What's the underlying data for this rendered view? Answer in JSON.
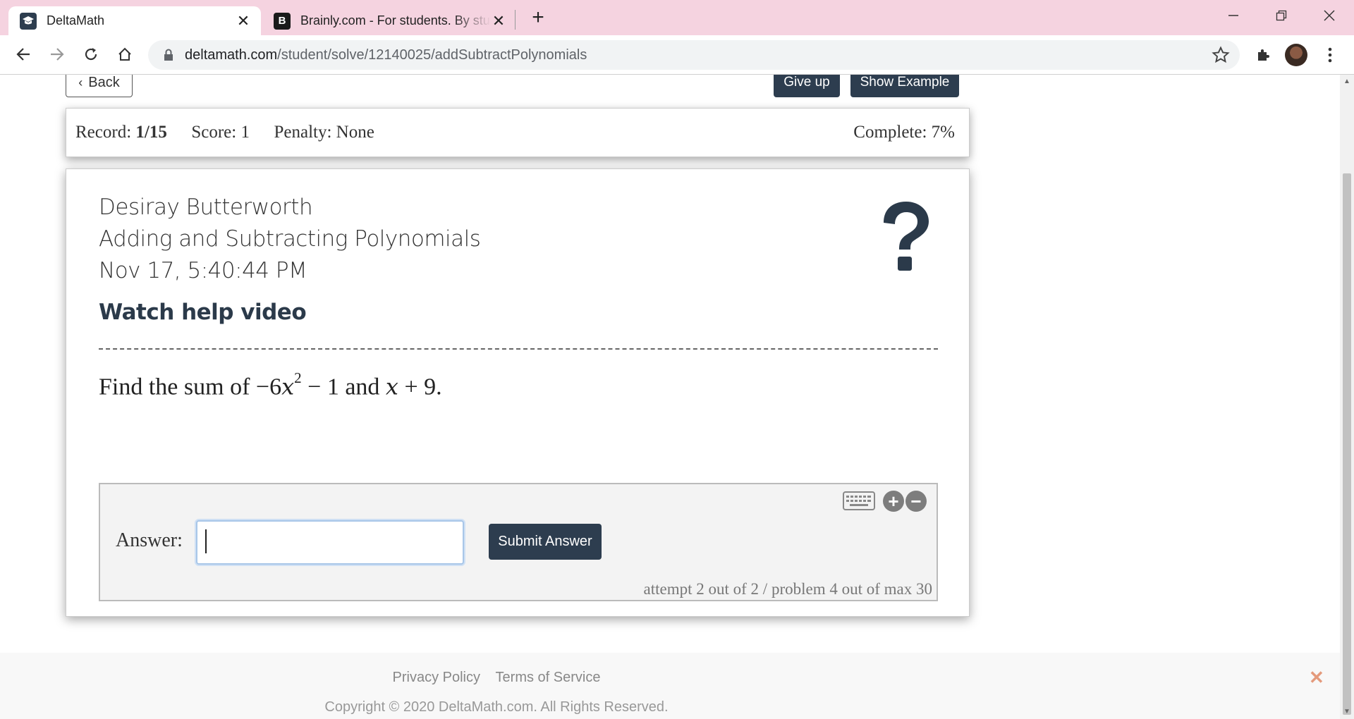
{
  "browser": {
    "tabs": [
      {
        "title": "DeltaMath",
        "active": true,
        "favicon": "deltamath-logo-icon"
      },
      {
        "title": "Brainly.com - For students. By students.",
        "active": false,
        "favicon": "brainly-logo-icon",
        "favicon_letter": "B"
      }
    ],
    "new_tab": "+",
    "url_host": "deltamath.com",
    "url_path": "/student/solve/12140025/addSubtractPolynomials"
  },
  "page": {
    "back_label": "Back",
    "give_up_label": "Give up",
    "show_example_label": "Show Example",
    "record": {
      "record_label": "Record:",
      "record_value": "1/15",
      "score_label": "Score:",
      "score_value": "1",
      "penalty_label": "Penalty:",
      "penalty_value": "None",
      "complete_label": "Complete:",
      "complete_value": "7%"
    },
    "student_name": "Desiray Butterworth",
    "topic": "Adding and Subtracting Polynomials",
    "timestamp": "Nov 17, 5:40:44 PM",
    "help_video_label": "Watch help video",
    "problem": {
      "prefix": "Find the sum of",
      "expr1_a": "−6",
      "expr1_var": "x",
      "expr1_exp": "2",
      "expr1_b": "− 1",
      "joiner": "and",
      "expr2_var": "x",
      "expr2_b": "+ 9",
      "suffix": "."
    },
    "answer_label": "Answer:",
    "answer_value": "",
    "submit_label": "Submit Answer",
    "attempt_text": "attempt 2 out of 2 / problem 4 out of max 30"
  },
  "footer": {
    "privacy": "Privacy Policy",
    "terms": "Terms of Service",
    "copyright": "Copyright © 2020 DeltaMath.com. All Rights Reserved."
  },
  "colors": {
    "tabstrip": "#f5d3e0",
    "primary_button": "#2d3d4f",
    "footer_close": "#e49a7c"
  }
}
